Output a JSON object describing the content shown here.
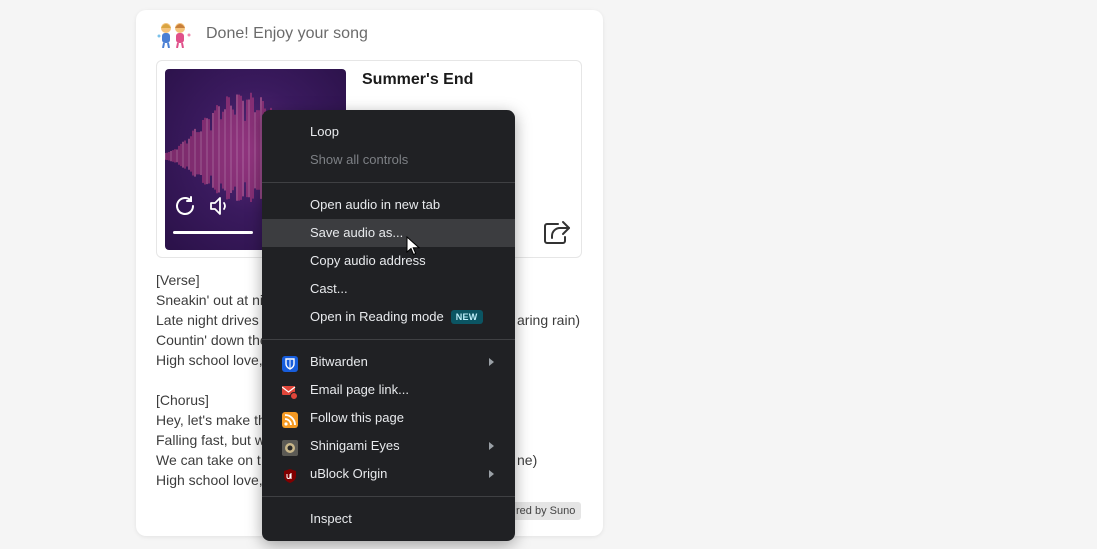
{
  "status": {
    "text": "Done! Enjoy your song",
    "icon": "party-people-icon"
  },
  "player": {
    "title": "Summer's End",
    "progress": 0.44
  },
  "lyrics": {
    "lines": [
      "[Verse]",
      "Sneakin' out at ni",
      "Late night drives",
      "Countin' down the",
      "High school love,",
      "",
      "[Chorus]",
      "Hey, let's make th",
      "Falling fast, but w",
      "We can take on t",
      "High school love,"
    ],
    "right_fragments": {
      "late_night": "aring rain)",
      "take_on": "ne)"
    }
  },
  "badge": {
    "text": "red by Suno"
  },
  "menu": {
    "items": [
      {
        "id": "loop",
        "label": "Loop"
      },
      {
        "id": "show-all-controls",
        "label": "Show all controls",
        "disabled": true
      },
      {
        "id": "open-audio",
        "label": "Open audio in new tab"
      },
      {
        "id": "save-audio",
        "label": "Save audio as..."
      },
      {
        "id": "copy-address",
        "label": "Copy audio address"
      },
      {
        "id": "cast",
        "label": "Cast..."
      },
      {
        "id": "reading-mode",
        "label": "Open in Reading mode",
        "badge": "NEW"
      },
      {
        "id": "bitwarden",
        "label": "Bitwarden"
      },
      {
        "id": "email-link",
        "label": "Email page link..."
      },
      {
        "id": "follow",
        "label": "Follow this page"
      },
      {
        "id": "shinigami",
        "label": "Shinigami Eyes"
      },
      {
        "id": "ublock",
        "label": "uBlock Origin"
      },
      {
        "id": "inspect",
        "label": "Inspect"
      }
    ]
  },
  "colors": {
    "menu_bg": "#202124",
    "menu_hover": "#3c3d40",
    "art_bg": "#3a1a5e",
    "new_badge": "#0b5563"
  }
}
